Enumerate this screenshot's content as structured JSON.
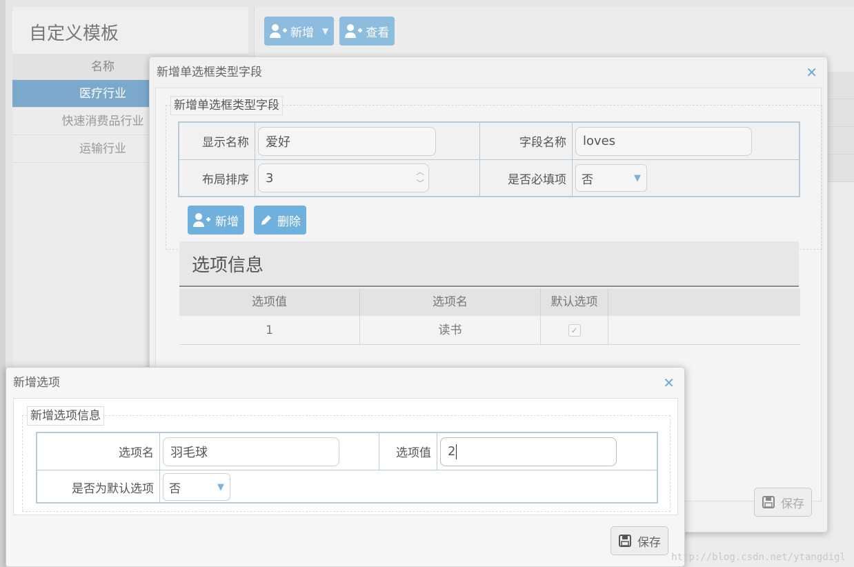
{
  "sidebar": {
    "title": "自定义模板",
    "header": "名称",
    "items": [
      {
        "label": "医疗行业",
        "active": true
      },
      {
        "label": "快速消费品行业",
        "active": false
      },
      {
        "label": "运输行业",
        "active": false
      }
    ]
  },
  "toolbar": {
    "add_label": "新增",
    "view_label": "查看"
  },
  "dialog_field": {
    "title": "新增单选框类型字段",
    "legend": "新增单选框类型字段",
    "labels": {
      "display_name": "显示名称",
      "field_name": "字段名称",
      "sort_order": "布局排序",
      "required": "是否必填项"
    },
    "values": {
      "display_name": "爱好",
      "field_name": "loves",
      "sort_order": "3",
      "required": "否"
    },
    "add_label": "新增",
    "delete_label": "删除",
    "section_title": "选项信息",
    "grid": {
      "columns": [
        "选项值",
        "选项名",
        "默认选项"
      ],
      "rows": [
        {
          "value": "1",
          "name": "读书",
          "default": true
        }
      ]
    },
    "save_label": "保存"
  },
  "dialog_option": {
    "title": "新增选项",
    "legend": "新增选项信息",
    "labels": {
      "option_name": "选项名",
      "option_value": "选项值",
      "is_default": "是否为默认选项"
    },
    "values": {
      "option_name": "羽毛球",
      "option_value": "2",
      "is_default": "否"
    },
    "save_label": "保存"
  },
  "watermark": "http://blog.csdn.net/ytangdigl",
  "colors": {
    "accent": "#6fb0dc",
    "close": "#6fa9d6",
    "active_row": "#7ba9cc"
  }
}
